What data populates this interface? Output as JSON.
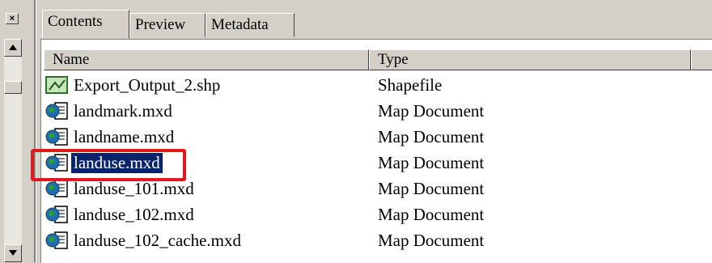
{
  "tabs": [
    {
      "label": "Contents"
    },
    {
      "label": "Preview"
    },
    {
      "label": "Metadata"
    }
  ],
  "columns": {
    "name": "Name",
    "type": "Type"
  },
  "rows": [
    {
      "name": "Export_Output_2.shp",
      "type": "Shapefile",
      "icon": "shapefile-icon"
    },
    {
      "name": "landmark.mxd",
      "type": "Map Document",
      "icon": "map-document-icon"
    },
    {
      "name": "landname.mxd",
      "type": "Map Document",
      "icon": "map-document-icon"
    },
    {
      "name": "landuse.mxd",
      "type": "Map Document",
      "icon": "map-document-icon",
      "selected": true
    },
    {
      "name": "landuse_101.mxd",
      "type": "Map Document",
      "icon": "map-document-icon"
    },
    {
      "name": "landuse_102.mxd",
      "type": "Map Document",
      "icon": "map-document-icon"
    },
    {
      "name": "landuse_102_cache.mxd",
      "type": "Map Document",
      "icon": "map-document-icon"
    }
  ],
  "close_label": "×",
  "colors": {
    "highlight": "#e0191e",
    "selection": "#0a246a",
    "window_bg": "#d4d0c8"
  }
}
